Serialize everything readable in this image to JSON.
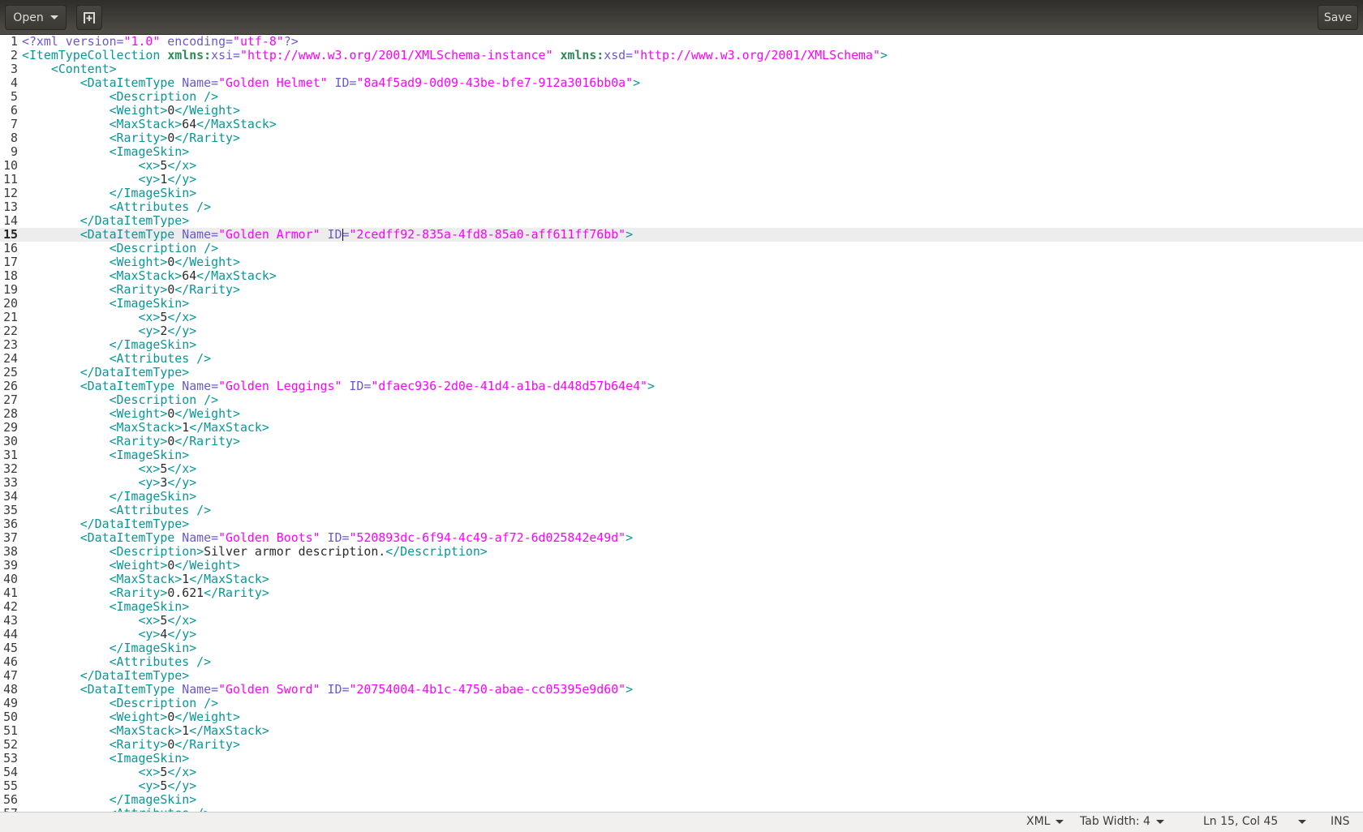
{
  "toolbar": {
    "open_label": "Open",
    "save_label": "Save",
    "new_tab_icon": "new-document-icon"
  },
  "colors": {
    "tag": "#0a9696",
    "attribute": "#6a5acd",
    "value": "#ff00ff",
    "namespace": "#2e8b57",
    "text": "#2b2b2b",
    "current_line": "#ededed"
  },
  "editor": {
    "current_line": 15,
    "cursor_col": 45,
    "lines": [
      [
        [
          "a",
          "<?xml version="
        ],
        [
          "v",
          "\"1.0\""
        ],
        [
          "a",
          " encoding="
        ],
        [
          "v",
          "\"utf-8\""
        ],
        [
          "a",
          "?>"
        ]
      ],
      [
        [
          "t",
          "<ItemTypeCollection "
        ],
        [
          "n",
          "xmlns:"
        ],
        [
          "a",
          "xsi="
        ],
        [
          "v",
          "\"http://www.w3.org/2001/XMLSchema-instance\""
        ],
        [
          "t",
          " "
        ],
        [
          "n",
          "xmlns:"
        ],
        [
          "a",
          "xsd="
        ],
        [
          "v",
          "\"http://www.w3.org/2001/XMLSchema\""
        ],
        [
          "t",
          ">"
        ]
      ],
      [
        [
          "t",
          "    <Content>"
        ]
      ],
      [
        [
          "t",
          "        <DataItemType "
        ],
        [
          "a",
          "Name="
        ],
        [
          "v",
          "\"Golden Helmet\""
        ],
        [
          "a",
          " ID="
        ],
        [
          "v",
          "\"8a4f5ad9-0d09-43be-bfe7-912a3016bb0a\""
        ],
        [
          "t",
          ">"
        ]
      ],
      [
        [
          "t",
          "            <Description />"
        ]
      ],
      [
        [
          "t",
          "            <Weight>"
        ],
        [
          "x",
          "0"
        ],
        [
          "t",
          "</Weight>"
        ]
      ],
      [
        [
          "t",
          "            <MaxStack>"
        ],
        [
          "x",
          "64"
        ],
        [
          "t",
          "</MaxStack>"
        ]
      ],
      [
        [
          "t",
          "            <Rarity>"
        ],
        [
          "x",
          "0"
        ],
        [
          "t",
          "</Rarity>"
        ]
      ],
      [
        [
          "t",
          "            <ImageSkin>"
        ]
      ],
      [
        [
          "t",
          "                <x>"
        ],
        [
          "x",
          "5"
        ],
        [
          "t",
          "</x>"
        ]
      ],
      [
        [
          "t",
          "                <y>"
        ],
        [
          "x",
          "1"
        ],
        [
          "t",
          "</y>"
        ]
      ],
      [
        [
          "t",
          "            </ImageSkin>"
        ]
      ],
      [
        [
          "t",
          "            <Attributes />"
        ]
      ],
      [
        [
          "t",
          "        </DataItemType>"
        ]
      ],
      [
        [
          "t",
          "        <DataItemType "
        ],
        [
          "a",
          "Name="
        ],
        [
          "v",
          "\"Golden Armor\""
        ],
        [
          "a",
          " ID="
        ],
        [
          "v",
          "\"2cedff92-835a-4fd8-85a0-aff611ff76bb\""
        ],
        [
          "t",
          ">"
        ]
      ],
      [
        [
          "t",
          "            <Description />"
        ]
      ],
      [
        [
          "t",
          "            <Weight>"
        ],
        [
          "x",
          "0"
        ],
        [
          "t",
          "</Weight>"
        ]
      ],
      [
        [
          "t",
          "            <MaxStack>"
        ],
        [
          "x",
          "64"
        ],
        [
          "t",
          "</MaxStack>"
        ]
      ],
      [
        [
          "t",
          "            <Rarity>"
        ],
        [
          "x",
          "0"
        ],
        [
          "t",
          "</Rarity>"
        ]
      ],
      [
        [
          "t",
          "            <ImageSkin>"
        ]
      ],
      [
        [
          "t",
          "                <x>"
        ],
        [
          "x",
          "5"
        ],
        [
          "t",
          "</x>"
        ]
      ],
      [
        [
          "t",
          "                <y>"
        ],
        [
          "x",
          "2"
        ],
        [
          "t",
          "</y>"
        ]
      ],
      [
        [
          "t",
          "            </ImageSkin>"
        ]
      ],
      [
        [
          "t",
          "            <Attributes />"
        ]
      ],
      [
        [
          "t",
          "        </DataItemType>"
        ]
      ],
      [
        [
          "t",
          "        <DataItemType "
        ],
        [
          "a",
          "Name="
        ],
        [
          "v",
          "\"Golden Leggings\""
        ],
        [
          "a",
          " ID="
        ],
        [
          "v",
          "\"dfaec936-2d0e-41d4-a1ba-d448d57b64e4\""
        ],
        [
          "t",
          ">"
        ]
      ],
      [
        [
          "t",
          "            <Description />"
        ]
      ],
      [
        [
          "t",
          "            <Weight>"
        ],
        [
          "x",
          "0"
        ],
        [
          "t",
          "</Weight>"
        ]
      ],
      [
        [
          "t",
          "            <MaxStack>"
        ],
        [
          "x",
          "1"
        ],
        [
          "t",
          "</MaxStack>"
        ]
      ],
      [
        [
          "t",
          "            <Rarity>"
        ],
        [
          "x",
          "0"
        ],
        [
          "t",
          "</Rarity>"
        ]
      ],
      [
        [
          "t",
          "            <ImageSkin>"
        ]
      ],
      [
        [
          "t",
          "                <x>"
        ],
        [
          "x",
          "5"
        ],
        [
          "t",
          "</x>"
        ]
      ],
      [
        [
          "t",
          "                <y>"
        ],
        [
          "x",
          "3"
        ],
        [
          "t",
          "</y>"
        ]
      ],
      [
        [
          "t",
          "            </ImageSkin>"
        ]
      ],
      [
        [
          "t",
          "            <Attributes />"
        ]
      ],
      [
        [
          "t",
          "        </DataItemType>"
        ]
      ],
      [
        [
          "t",
          "        <DataItemType "
        ],
        [
          "a",
          "Name="
        ],
        [
          "v",
          "\"Golden Boots\""
        ],
        [
          "a",
          " ID="
        ],
        [
          "v",
          "\"520893dc-6f94-4c49-af72-6d025842e49d\""
        ],
        [
          "t",
          ">"
        ]
      ],
      [
        [
          "t",
          "            <Description>"
        ],
        [
          "x",
          "Silver armor description."
        ],
        [
          "t",
          "</Description>"
        ]
      ],
      [
        [
          "t",
          "            <Weight>"
        ],
        [
          "x",
          "0"
        ],
        [
          "t",
          "</Weight>"
        ]
      ],
      [
        [
          "t",
          "            <MaxStack>"
        ],
        [
          "x",
          "1"
        ],
        [
          "t",
          "</MaxStack>"
        ]
      ],
      [
        [
          "t",
          "            <Rarity>"
        ],
        [
          "x",
          "0.621"
        ],
        [
          "t",
          "</Rarity>"
        ]
      ],
      [
        [
          "t",
          "            <ImageSkin>"
        ]
      ],
      [
        [
          "t",
          "                <x>"
        ],
        [
          "x",
          "5"
        ],
        [
          "t",
          "</x>"
        ]
      ],
      [
        [
          "t",
          "                <y>"
        ],
        [
          "x",
          "4"
        ],
        [
          "t",
          "</y>"
        ]
      ],
      [
        [
          "t",
          "            </ImageSkin>"
        ]
      ],
      [
        [
          "t",
          "            <Attributes />"
        ]
      ],
      [
        [
          "t",
          "        </DataItemType>"
        ]
      ],
      [
        [
          "t",
          "        <DataItemType "
        ],
        [
          "a",
          "Name="
        ],
        [
          "v",
          "\"Golden Sword\""
        ],
        [
          "a",
          " ID="
        ],
        [
          "v",
          "\"20754004-4b1c-4750-abae-cc05395e9d60\""
        ],
        [
          "t",
          ">"
        ]
      ],
      [
        [
          "t",
          "            <Description />"
        ]
      ],
      [
        [
          "t",
          "            <Weight>"
        ],
        [
          "x",
          "0"
        ],
        [
          "t",
          "</Weight>"
        ]
      ],
      [
        [
          "t",
          "            <MaxStack>"
        ],
        [
          "x",
          "1"
        ],
        [
          "t",
          "</MaxStack>"
        ]
      ],
      [
        [
          "t",
          "            <Rarity>"
        ],
        [
          "x",
          "0"
        ],
        [
          "t",
          "</Rarity>"
        ]
      ],
      [
        [
          "t",
          "            <ImageSkin>"
        ]
      ],
      [
        [
          "t",
          "                <x>"
        ],
        [
          "x",
          "5"
        ],
        [
          "t",
          "</x>"
        ]
      ],
      [
        [
          "t",
          "                <y>"
        ],
        [
          "x",
          "5"
        ],
        [
          "t",
          "</y>"
        ]
      ],
      [
        [
          "t",
          "            </ImageSkin>"
        ]
      ],
      [
        [
          "t",
          "            <Attributes />"
        ]
      ]
    ]
  },
  "statusbar": {
    "language": "XML",
    "tab_width": "Tab Width: 4",
    "position": "Ln 15, Col 45",
    "mode": "INS"
  }
}
